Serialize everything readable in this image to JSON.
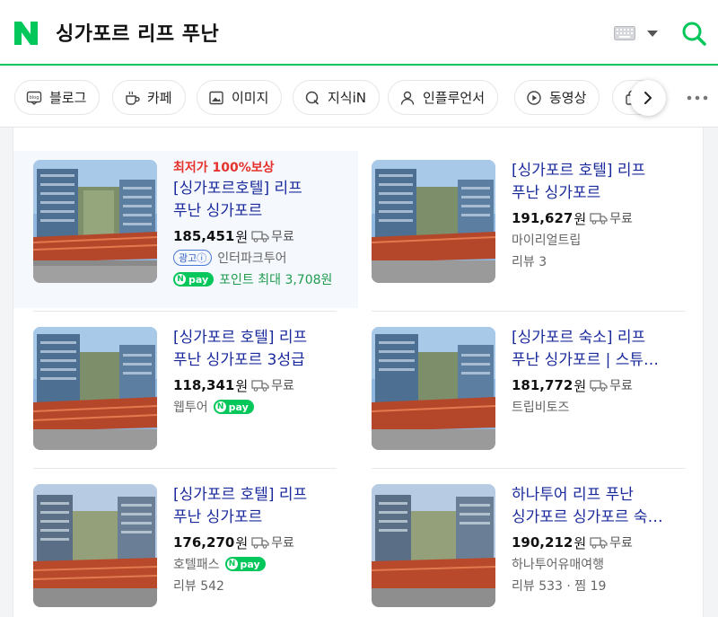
{
  "search": {
    "query": "싱가포르 리프 푸난"
  },
  "icons": {
    "logo": "naver-n-logo",
    "keyboard": "keyboard-icon",
    "search": "search-icon",
    "more": "more-icon"
  },
  "tabs": [
    {
      "label": "블로그",
      "icon": "blog-icon"
    },
    {
      "label": "카페",
      "icon": "cafe-icon"
    },
    {
      "label": "이미지",
      "icon": "image-icon"
    },
    {
      "label": "지식iN",
      "icon": "kin-icon"
    },
    {
      "label": "인플루언서",
      "icon": "person-icon"
    },
    {
      "label": "동영상",
      "icon": "video-icon"
    }
  ],
  "brand_color": "#03c75a",
  "products": [
    {
      "promo": "최저가 100%보상",
      "title": "[싱가포르호텔] 리프 푸난 싱가포르",
      "price": "185,451",
      "currency": "원",
      "shipping": "무료",
      "ad_label": "광고ⓘ",
      "seller": "인터파크투어",
      "npay_label": "pay",
      "points": "포인트 최대 3,708원"
    },
    {
      "title": "[싱가포르 호텔] 리프 푸난 싱가포르",
      "price": "191,627",
      "currency": "원",
      "shipping": "무료",
      "seller": "마이리얼트립",
      "review": "리뷰 3"
    },
    {
      "title": "[싱가포르 호텔] 리프 푸난 싱가포르 3성급",
      "price": "118,341",
      "currency": "원",
      "shipping": "무료",
      "seller": "웹투어",
      "npay_label": "pay"
    },
    {
      "title": "[싱가포르 숙소] 리프 푸난 싱가포르 | 스튜…",
      "price": "181,772",
      "currency": "원",
      "shipping": "무료",
      "seller": "트립비토즈"
    },
    {
      "title": "[싱가포르 호텔] 리프 푸난 싱가포르",
      "price": "176,270",
      "currency": "원",
      "shipping": "무료",
      "seller": "호텔패스",
      "npay_label": "pay",
      "review": "리뷰 542"
    },
    {
      "title": "하나투어 리프 푸난 싱가포르 싱가포르 숙…",
      "price": "190,212",
      "currency": "원",
      "shipping": "무료",
      "seller": "하나투어유매여행",
      "review": "리뷰 533 · 찜 19"
    }
  ]
}
